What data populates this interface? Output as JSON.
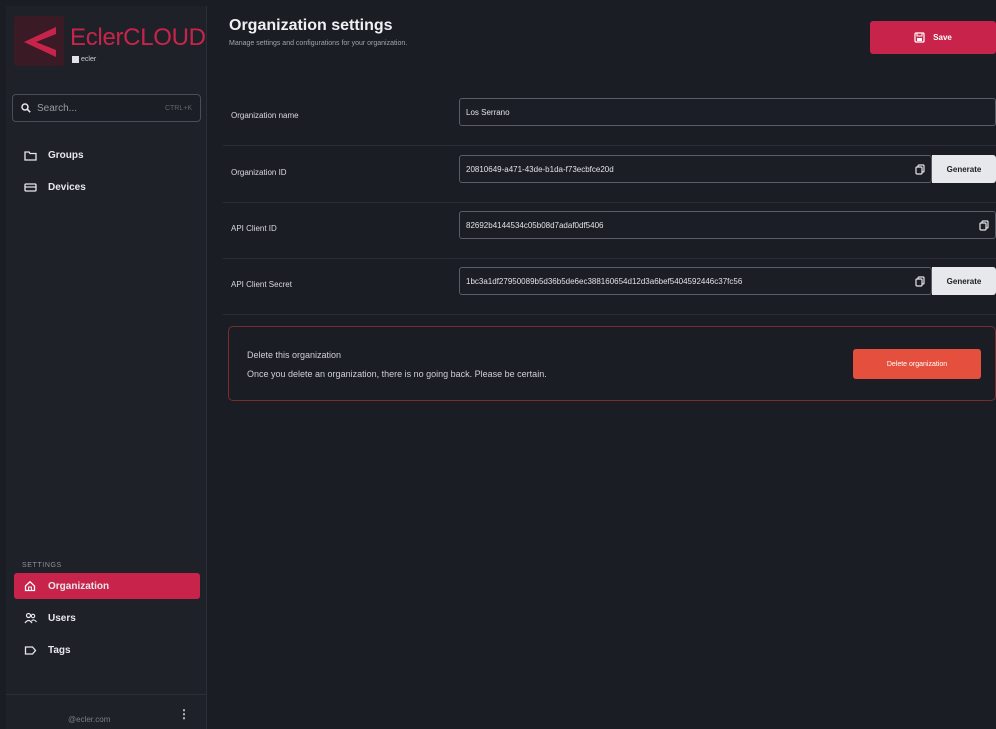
{
  "brand": {
    "name": "EclerCLOUD",
    "sub": "ecler"
  },
  "search": {
    "placeholder": "Search...",
    "shortcut": "CTRL+K"
  },
  "nav": {
    "groups": "Groups",
    "devices": "Devices"
  },
  "settings": {
    "section_label": "SETTINGS",
    "organization": "Organization",
    "users": "Users",
    "tags": "Tags"
  },
  "footer": {
    "email": "@ecler.com"
  },
  "header": {
    "title": "Organization settings",
    "subtitle": "Manage settings and configurations for your organization.",
    "save_label": "Save"
  },
  "fields": {
    "org_name_label": "Organization name",
    "org_name_value": "Los Serrano",
    "org_id_label": "Organization ID",
    "org_id_value": "20810649-a471-43de-b1da-f73ecbfce20d",
    "api_client_id_label": "API Client ID",
    "api_client_id_value": "82692b4144534c05b08d7adaf0df5406",
    "api_client_secret_label": "API Client Secret",
    "api_client_secret_value": "1bc3a1df27950089b5d36b5de6ec388160654d12d3a6bef5404592446c37fc56",
    "generate_label": "Generate"
  },
  "danger": {
    "title": "Delete this organization",
    "description": "Once you delete an organization, there is no going back. Please be certain.",
    "button_label": "Delete organization"
  },
  "colors": {
    "accent": "#c8244b",
    "danger_button": "#e4503d",
    "background": "#1b1d24"
  }
}
